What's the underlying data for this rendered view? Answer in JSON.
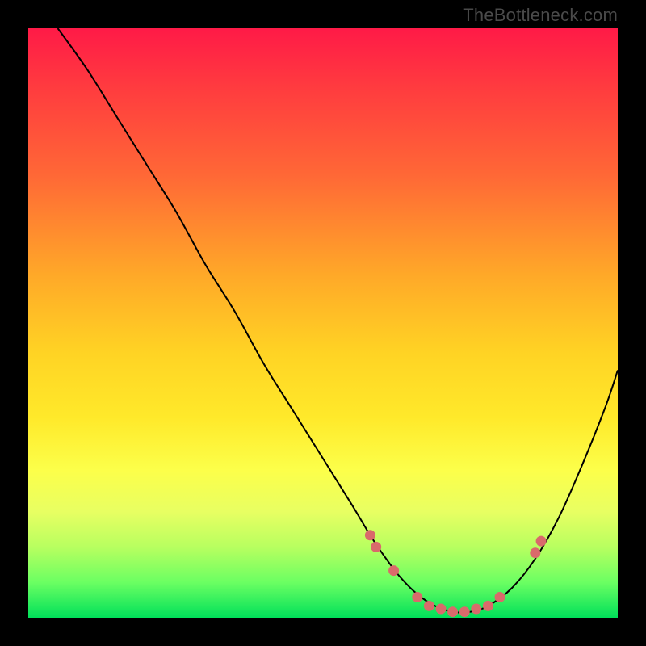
{
  "watermark": "TheBottleneck.com",
  "chart_data": {
    "type": "line",
    "title": "",
    "xlabel": "",
    "ylabel": "",
    "xlim": [
      0,
      100
    ],
    "ylim": [
      0,
      100
    ],
    "grid": false,
    "legend": false,
    "series": [
      {
        "name": "bottleneck-curve",
        "x": [
          5,
          10,
          15,
          20,
          25,
          30,
          35,
          40,
          45,
          50,
          55,
          58,
          60,
          63,
          66,
          69,
          72,
          75,
          78,
          82,
          86,
          90,
          94,
          98,
          100
        ],
        "y": [
          100,
          93,
          85,
          77,
          69,
          60,
          52,
          43,
          35,
          27,
          19,
          14,
          11,
          7,
          4,
          2,
          1,
          1,
          2,
          5,
          10,
          17,
          26,
          36,
          42
        ],
        "stroke": "#000000"
      }
    ],
    "markers": {
      "name": "highlight-points",
      "color": "#d96a6b",
      "points": [
        {
          "x": 58,
          "y": 14
        },
        {
          "x": 59,
          "y": 12
        },
        {
          "x": 62,
          "y": 8
        },
        {
          "x": 66,
          "y": 3.5
        },
        {
          "x": 68,
          "y": 2
        },
        {
          "x": 70,
          "y": 1.5
        },
        {
          "x": 72,
          "y": 1
        },
        {
          "x": 74,
          "y": 1
        },
        {
          "x": 76,
          "y": 1.5
        },
        {
          "x": 78,
          "y": 2
        },
        {
          "x": 80,
          "y": 3.5
        },
        {
          "x": 86,
          "y": 11
        },
        {
          "x": 87,
          "y": 13
        }
      ]
    },
    "background_gradient": {
      "direction": "top-to-bottom",
      "stops": [
        {
          "pos": 0,
          "color": "#ff1a47"
        },
        {
          "pos": 25,
          "color": "#ff6836"
        },
        {
          "pos": 55,
          "color": "#ffd324"
        },
        {
          "pos": 82,
          "color": "#e8ff62"
        },
        {
          "pos": 100,
          "color": "#00e05a"
        }
      ]
    }
  }
}
